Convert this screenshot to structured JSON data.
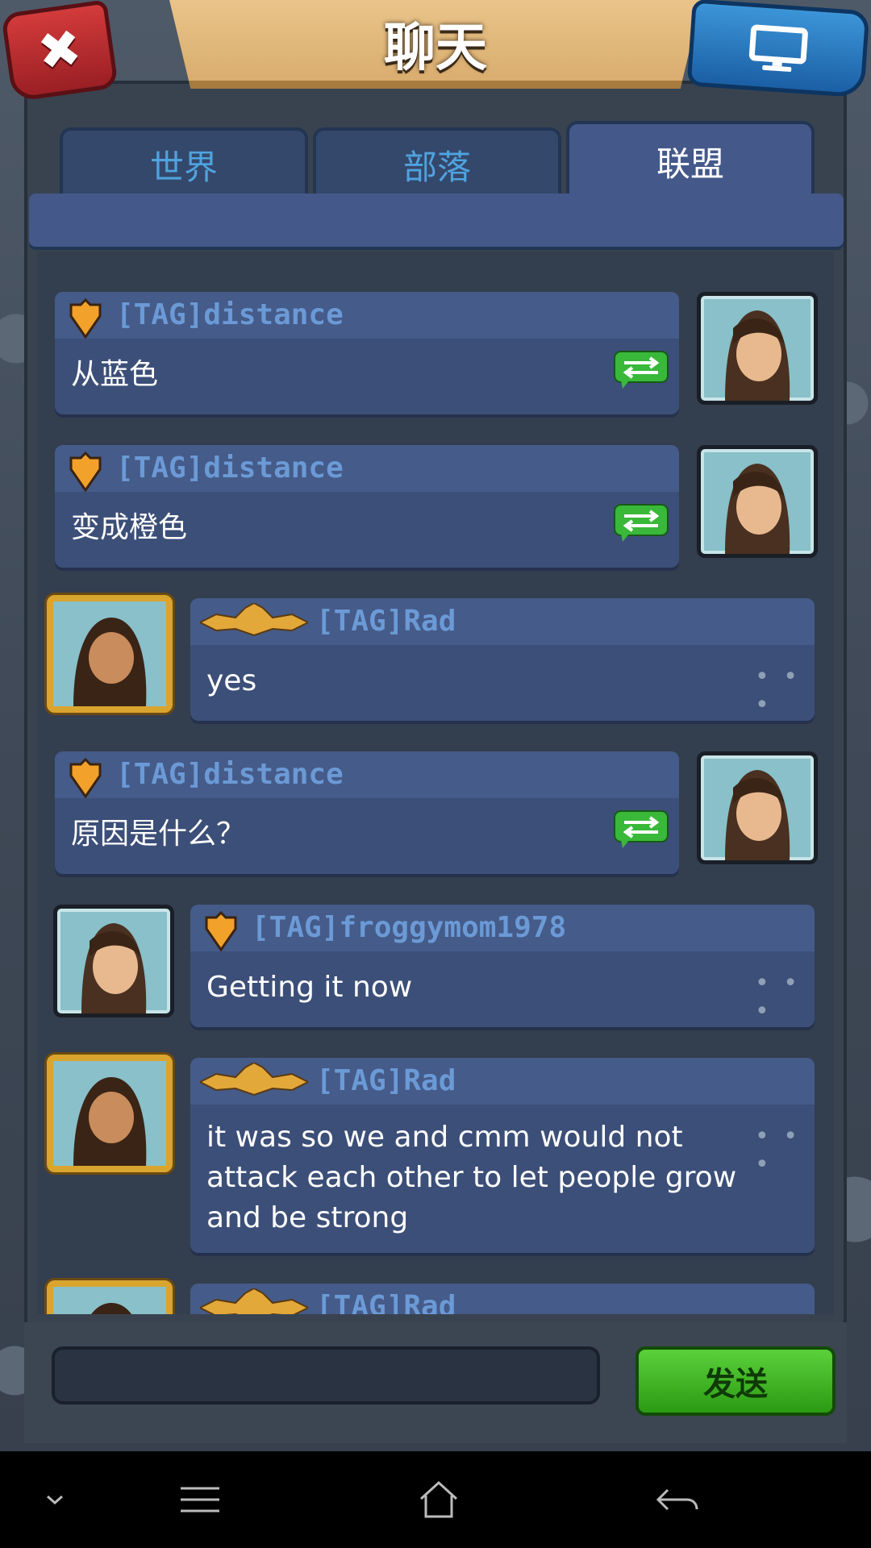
{
  "header": {
    "title": "聊天"
  },
  "tabs": [
    {
      "label": "世界",
      "active": false
    },
    {
      "label": "部落",
      "active": false
    },
    {
      "label": "联盟",
      "active": true
    }
  ],
  "messages": [
    {
      "name": "[TAG]distance",
      "text": "从蓝色"
    },
    {
      "name": "[TAG]distance",
      "text": "变成橙色"
    },
    {
      "name": "[TAG]Rad",
      "text": "yes"
    },
    {
      "name": "[TAG]distance",
      "text": "原因是什么？"
    },
    {
      "name": "[TAG]froggymom1978",
      "text": "Getting it now"
    },
    {
      "name": "[TAG]Rad",
      "text": "it was so we and cmm would not attack each other to let people grow and be strong"
    },
    {
      "name": "[TAG]Rad",
      "text": ""
    }
  ],
  "composer": {
    "input_value": "",
    "send_label": "发送"
  },
  "colors": {
    "accent_green": "#2c9a14",
    "name_blue": "#6b9ad6",
    "title_tan": "#e9c48a"
  }
}
